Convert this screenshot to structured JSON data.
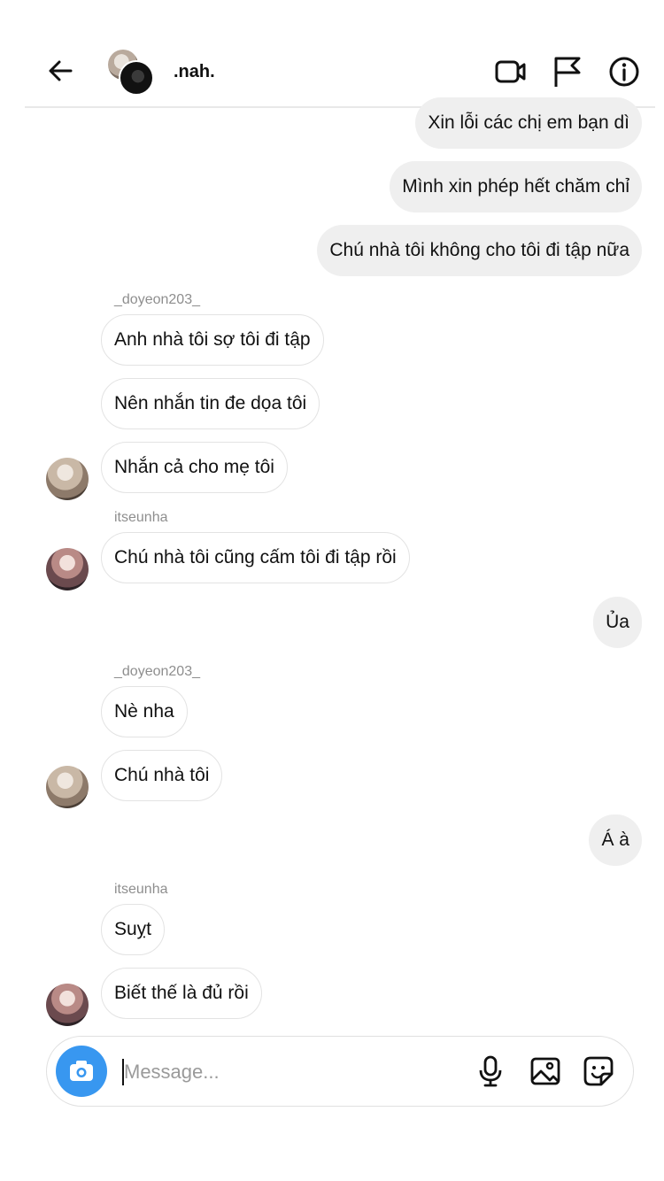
{
  "header": {
    "title": ".nah."
  },
  "messages": [
    {
      "dir": "out",
      "text": "Xin lỗi các chị em bạn dì"
    },
    {
      "dir": "out",
      "text": "Mình xin phép hết chăm chỉ"
    },
    {
      "dir": "out",
      "text": "Chú nhà tôi không cho tôi đi tập nữa"
    },
    {
      "dir": "sender",
      "text": "_doyeon203_"
    },
    {
      "dir": "in",
      "text": "Anh nhà tôi sợ tôi đi tập"
    },
    {
      "dir": "in",
      "text": "Nên nhắn tin đe dọa tôi"
    },
    {
      "dir": "in",
      "text": "Nhắn cả cho mẹ tôi"
    },
    {
      "dir": "sender",
      "text": "itseunha"
    },
    {
      "dir": "in",
      "text": "Chú nhà tôi cũng cấm tôi đi tập rồi"
    },
    {
      "dir": "out",
      "text": "Ủa"
    },
    {
      "dir": "sender",
      "text": "_doyeon203_"
    },
    {
      "dir": "in",
      "text": "Nè nha"
    },
    {
      "dir": "in",
      "text": "Chú nhà tôi"
    },
    {
      "dir": "out",
      "text": "Á à"
    },
    {
      "dir": "sender",
      "text": "itseunha"
    },
    {
      "dir": "in",
      "text": "Suỵt"
    },
    {
      "dir": "in",
      "text": "Biết thế là đủ rồi"
    }
  ],
  "composer": {
    "placeholder": "Message..."
  },
  "colors": {
    "outgoing_bubble": "#efefef",
    "camera_button": "#3897f0"
  },
  "icons": [
    "back-arrow-icon",
    "video-call-icon",
    "flag-icon",
    "info-icon",
    "camera-icon",
    "microphone-icon",
    "gallery-icon",
    "sticker-icon"
  ]
}
